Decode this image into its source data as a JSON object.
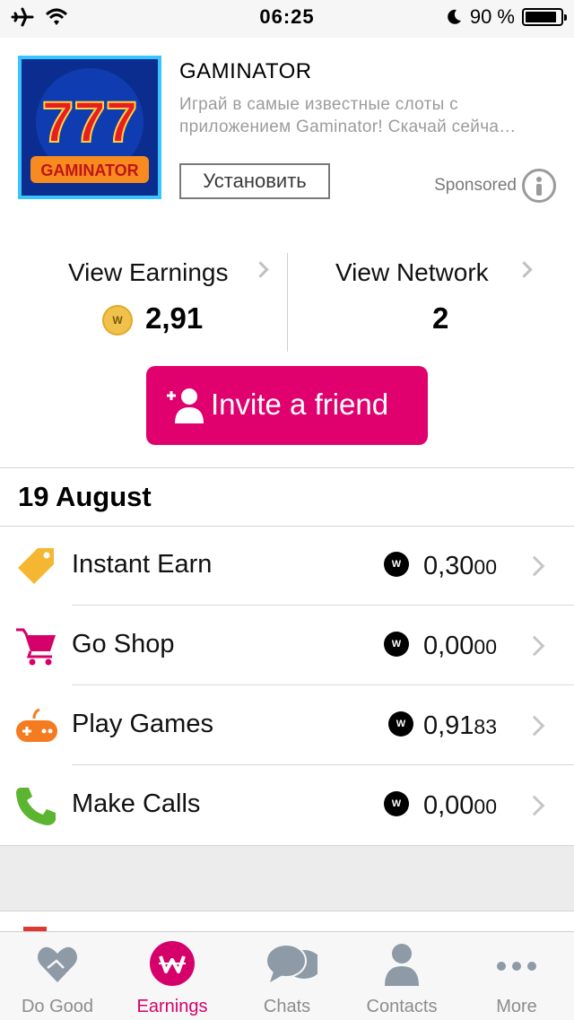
{
  "status_bar": {
    "time": "06:25",
    "battery_percent": "90 %",
    "battery_level": 0.9,
    "icons": [
      "airplane-icon",
      "wifi-icon",
      "moon-icon",
      "battery-icon"
    ]
  },
  "ad": {
    "app_name": "GAMINATOR",
    "description_line1": "Играй в самые известные слоты с",
    "description_line2": "приложением Gaminator! Скачай сейча…",
    "install_label": "Установить",
    "sponsored_label": "Sponsored",
    "logo_text": "777",
    "logo_brand": "GAMINATOR"
  },
  "stats": {
    "earnings_label": "View Earnings",
    "earnings_value": "2,91",
    "network_label": "View Network",
    "network_value": "2",
    "coin_symbol": "W"
  },
  "invite": {
    "label": "Invite a friend",
    "color": "#e0006e"
  },
  "section": {
    "date": "19 August"
  },
  "activities": [
    {
      "label": "Instant Earn",
      "amount_main": "0,30",
      "amount_small": "00",
      "icon": "tag-icon",
      "color": "#f5b731"
    },
    {
      "label": "Go Shop",
      "amount_main": "0,00",
      "amount_small": "00",
      "icon": "cart-icon",
      "color": "#d6006a"
    },
    {
      "label": "Play Games",
      "amount_main": "0,91",
      "amount_small": "83",
      "icon": "gamepad-icon",
      "color": "#f47b20"
    },
    {
      "label": "Make Calls",
      "amount_main": "0,00",
      "amount_small": "00",
      "icon": "phone-icon",
      "color": "#5cb531"
    }
  ],
  "tabs": [
    {
      "label": "Do Good",
      "icon": "heart-hands-icon",
      "active": false
    },
    {
      "label": "Earnings",
      "icon": "w-coin-icon",
      "active": true
    },
    {
      "label": "Chats",
      "icon": "chat-bubbles-icon",
      "active": false
    },
    {
      "label": "Contacts",
      "icon": "person-icon",
      "active": false
    },
    {
      "label": "More",
      "icon": "more-dots-icon",
      "active": false
    }
  ],
  "colors": {
    "accent": "#d6006a",
    "inactive_tab": "#8c8c8c"
  }
}
